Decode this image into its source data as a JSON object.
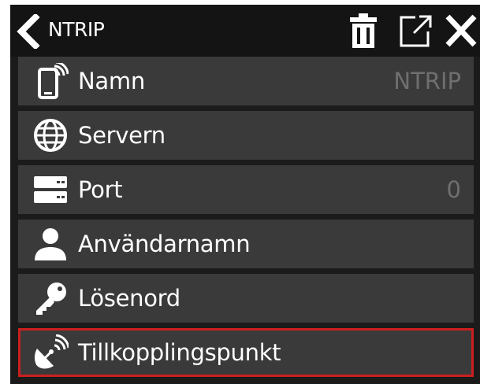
{
  "header": {
    "title": "NTRIP",
    "back_icon": "chevron-left-icon",
    "actions": [
      {
        "name": "delete",
        "icon": "trash-icon"
      },
      {
        "name": "open-external",
        "icon": "external-link-icon"
      },
      {
        "name": "close",
        "icon": "close-icon"
      }
    ]
  },
  "fields": [
    {
      "label": "Namn",
      "value": "NTRIP",
      "icon": "phone-signal-icon"
    },
    {
      "label": "Servern",
      "value": "",
      "icon": "globe-icon"
    },
    {
      "label": "Port",
      "value": "0",
      "icon": "server-icon"
    },
    {
      "label": "Användarnamn",
      "value": "",
      "icon": "user-icon"
    },
    {
      "label": "Lösenord",
      "value": "",
      "icon": "key-icon"
    },
    {
      "label": "Tillkopplingspunkt",
      "value": "",
      "icon": "satellite-dish-icon",
      "selected": true
    }
  ],
  "colors": {
    "background": "#1b1b1b",
    "row": "#3a3a3a",
    "selection_border": "#cc1f1f",
    "value_text": "#6f6f6f"
  }
}
